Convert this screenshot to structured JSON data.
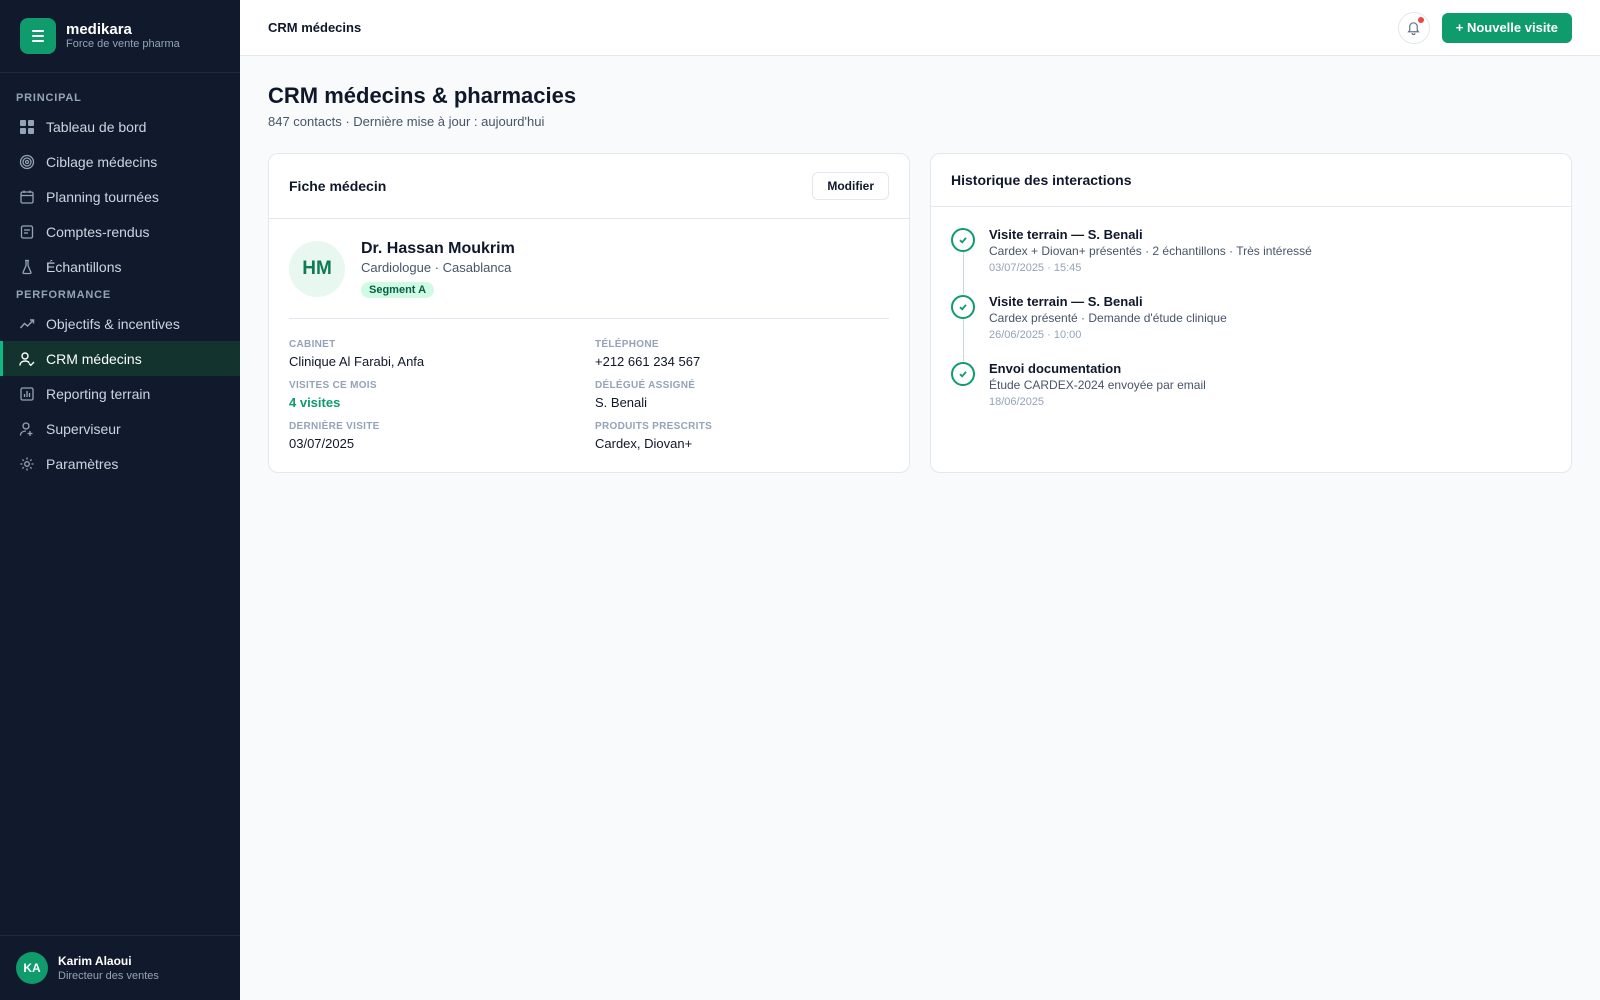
{
  "brand": {
    "name": "medikara",
    "subtitle": "Force de vente pharma",
    "logo_icon": "menu-lines-icon",
    "color": "#0f9b6c"
  },
  "sidebar": {
    "sections": [
      {
        "label": "PRINCIPAL",
        "items": [
          {
            "label": "Tableau de bord",
            "icon": "grid-icon"
          },
          {
            "label": "Ciblage médecins",
            "icon": "target-icon"
          },
          {
            "label": "Planning tournées",
            "icon": "calendar-icon"
          },
          {
            "label": "Comptes-rendus",
            "icon": "report-icon"
          },
          {
            "label": "Échantillons",
            "icon": "flask-icon"
          }
        ]
      },
      {
        "label": "PERFORMANCE",
        "items": [
          {
            "label": "Objectifs & incentives",
            "icon": "trend-icon"
          },
          {
            "label": "CRM médecins",
            "icon": "user-check-icon",
            "active": true
          },
          {
            "label": "Reporting terrain",
            "icon": "chart-icon"
          },
          {
            "label": "Superviseur",
            "icon": "user-icon"
          },
          {
            "label": "Paramètres",
            "icon": "gear-icon"
          }
        ]
      }
    ]
  },
  "user": {
    "initials": "KA",
    "name": "Karim Alaoui",
    "role": "Directeur des ventes"
  },
  "topbar": {
    "title": "CRM médecins",
    "new_visit": "+ Nouvelle visite",
    "notification_dot": "#ef4444"
  },
  "page": {
    "title": "CRM médecins & pharmacies",
    "subtitle": "847 contacts · Dernière mise à jour : aujourd'hui"
  },
  "doctor_card": {
    "title": "Fiche médecin",
    "edit_label": "Modifier",
    "initials": "HM",
    "name": "Dr. Hassan Moukrim",
    "specialty": "Cardiologue · Casablanca",
    "segment": "Segment A",
    "fields": [
      {
        "label": "CABINET",
        "value": "Clinique Al Farabi, Anfa"
      },
      {
        "label": "TÉLÉPHONE",
        "value": "+212 661 234 567"
      },
      {
        "label": "VISITES CE MOIS",
        "value": "4 visites",
        "accent": true
      },
      {
        "label": "DÉLÉGUÉ ASSIGNÉ",
        "value": "S. Benali"
      },
      {
        "label": "DERNIÈRE VISITE",
        "value": "03/07/2025"
      },
      {
        "label": "PRODUITS PRESCRITS",
        "value": "Cardex, Diovan+"
      }
    ]
  },
  "history": {
    "title": "Historique des interactions",
    "items": [
      {
        "title": "Visite terrain — S. Benali",
        "desc": "Cardex + Diovan+ présentés · 2 échantillons · Très intéressé",
        "time": "03/07/2025 · 15:45"
      },
      {
        "title": "Visite terrain — S. Benali",
        "desc": "Cardex présenté · Demande d'étude clinique",
        "time": "26/06/2025 · 10:00"
      },
      {
        "title": "Envoi documentation",
        "desc": "Étude CARDEX-2024 envoyée par email",
        "time": "18/06/2025"
      }
    ]
  }
}
